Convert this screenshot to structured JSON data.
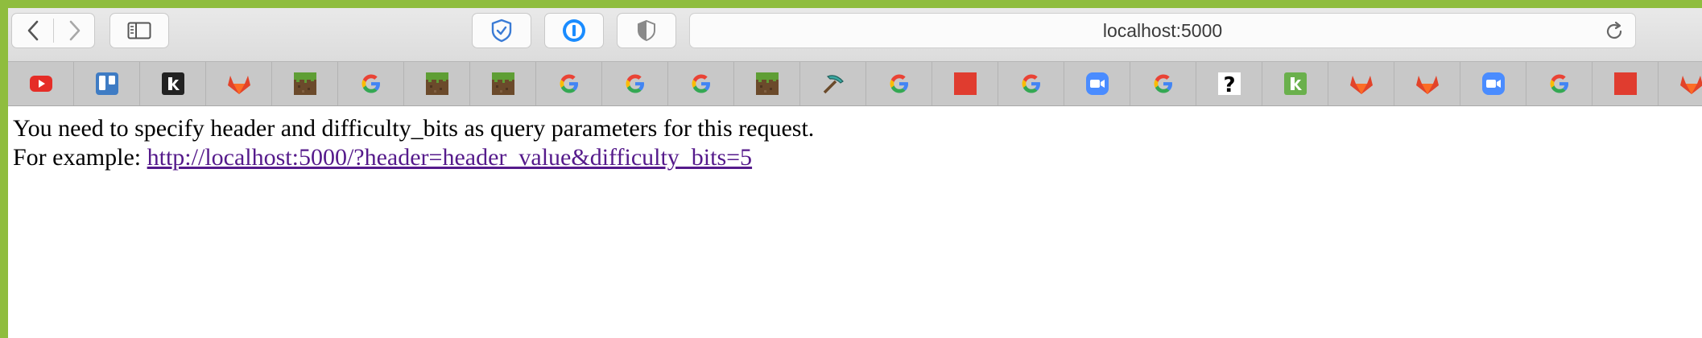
{
  "browser": {
    "url": "localhost:5000"
  },
  "bookmarks": [
    "youtube-icon",
    "trello-icon",
    "bitbucket-icon",
    "gitlab-icon",
    "minecraft-grass-icon",
    "google-icon",
    "minecraft-grass-icon",
    "minecraft-grass-icon",
    "google-icon",
    "google-icon",
    "google-icon",
    "minecraft-grass-icon",
    "minecraft-pickaxe-icon",
    "google-icon",
    "red-square-icon",
    "google-icon",
    "zoom-icon",
    "google-icon",
    "question-mark-icon",
    "bitbucket-green-icon",
    "gitlab-icon",
    "gitlab-icon",
    "zoom-icon",
    "google-icon",
    "red-square-icon",
    "gitlab-icon"
  ],
  "page": {
    "message": "You need to specify header and difficulty_bits as query parameters for this request.",
    "example_label": "For example:",
    "example_link": "http://localhost:5000/?header=header_value&difficulty_bits=5"
  },
  "colors": {
    "desktop": "#8fbd3e",
    "link": "#551a8b",
    "toolbar": "#e0e0e0",
    "bookmark_bar": "#c8c8c8"
  }
}
